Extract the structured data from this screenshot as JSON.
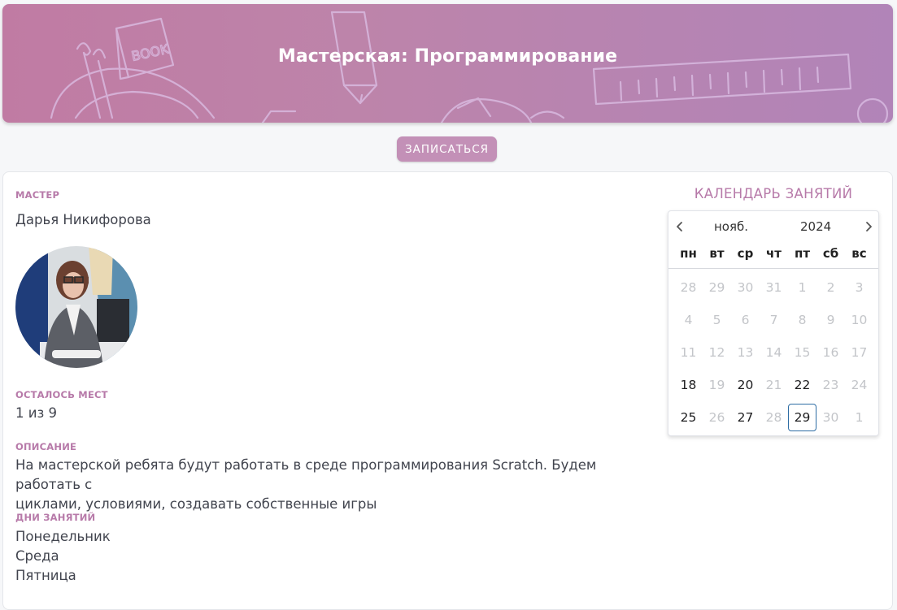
{
  "header": {
    "title": "Мастерская: Программирование"
  },
  "enroll_button": "ЗАПИСАТЬСЯ",
  "master": {
    "label": "МАСТЕР",
    "name": "Дарья Никифорова"
  },
  "seats": {
    "label": "ОСТАЛОСЬ МЕСТ",
    "value": "1 из 9"
  },
  "description": {
    "label": "ОПИСАНИЕ",
    "line1": "На мастерской ребята будут работать в среде программирования Scratch. Будем работать с",
    "line2": "циклами, условиями, создавать собственные игры"
  },
  "days": {
    "label": "ДНИ ЗАНЯТИЙ",
    "items": [
      "Понедельник",
      "Среда",
      "Пятница"
    ]
  },
  "calendar": {
    "title": "КАЛЕНДАРЬ ЗАНЯТИЙ",
    "month": "нояб.",
    "year": "2024",
    "prev_icon": "chevron-left-icon",
    "next_icon": "chevron-right-icon",
    "weekdays": [
      "пн",
      "вт",
      "ср",
      "чт",
      "пт",
      "сб",
      "вс"
    ],
    "weeks": [
      [
        {
          "d": "28",
          "active": false
        },
        {
          "d": "29",
          "active": false
        },
        {
          "d": "30",
          "active": false
        },
        {
          "d": "31",
          "active": false
        },
        {
          "d": "1",
          "active": false
        },
        {
          "d": "2",
          "active": false
        },
        {
          "d": "3",
          "active": false
        }
      ],
      [
        {
          "d": "4",
          "active": false
        },
        {
          "d": "5",
          "active": false
        },
        {
          "d": "6",
          "active": false
        },
        {
          "d": "7",
          "active": false
        },
        {
          "d": "8",
          "active": false
        },
        {
          "d": "9",
          "active": false
        },
        {
          "d": "10",
          "active": false
        }
      ],
      [
        {
          "d": "11",
          "active": false
        },
        {
          "d": "12",
          "active": false
        },
        {
          "d": "13",
          "active": false
        },
        {
          "d": "14",
          "active": false
        },
        {
          "d": "15",
          "active": false
        },
        {
          "d": "16",
          "active": false
        },
        {
          "d": "17",
          "active": false
        }
      ],
      [
        {
          "d": "18",
          "active": true
        },
        {
          "d": "19",
          "active": false
        },
        {
          "d": "20",
          "active": true
        },
        {
          "d": "21",
          "active": false
        },
        {
          "d": "22",
          "active": true
        },
        {
          "d": "23",
          "active": false
        },
        {
          "d": "24",
          "active": false
        }
      ],
      [
        {
          "d": "25",
          "active": true
        },
        {
          "d": "26",
          "active": false
        },
        {
          "d": "27",
          "active": true
        },
        {
          "d": "28",
          "active": false
        },
        {
          "d": "29",
          "active": true,
          "today": true
        },
        {
          "d": "30",
          "active": false
        },
        {
          "d": "1",
          "active": false
        }
      ]
    ]
  },
  "colors": {
    "accent": "#b77aa9",
    "button": "#c390b7",
    "today_border": "#2e6da4"
  }
}
